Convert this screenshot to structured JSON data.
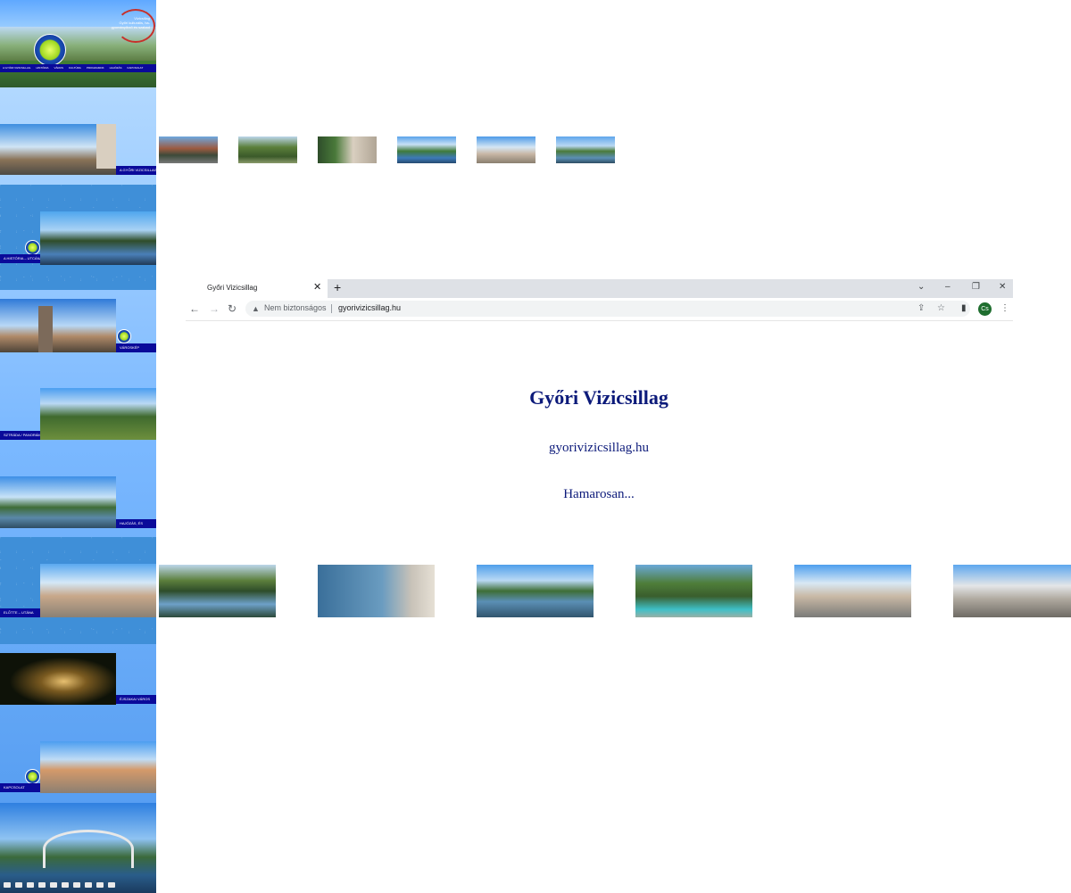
{
  "browser": {
    "tab_title": "Győri Vizicsillag",
    "security_label": "Nem biztonságos",
    "url": "gyorivizicsillag.hu",
    "profile_initials": "Cs"
  },
  "page": {
    "title": "Győri Vizicsillag",
    "domain": "gyorivizicsillag.hu",
    "status": "Hamarosan..."
  },
  "strip": {
    "header_logo_text": [
      "Vízicsillag",
      "Győri kulturális, ha-",
      "gyományőrző és szabad"
    ],
    "nav_items": [
      "A GYŐRI VIZICSILLAG",
      "HISTÓRIA",
      "VÁROS",
      "KULTÚRA",
      "PROGRAMOK",
      "HAJÓZÁS",
      "KAPCSOLAT"
    ],
    "panels": [
      {
        "bar_label": "A GYŐRI VIZICSILLAG"
      },
      {
        "bar_label": "A HISTÓRIA – UTCÁNAK"
      },
      {
        "bar_label": "VÁROSKÉP"
      },
      {
        "bar_label": "SZTRÁDA / PANORÁMA"
      },
      {
        "bar_label": "HAJÓZÁS, ÉS"
      },
      {
        "bar_label": "ELŐTTE – UTÁNA"
      },
      {
        "bar_label": "ÉJSZAKAI VÁROS"
      },
      {
        "bar_label": "KAPCSOLAT"
      }
    ]
  },
  "colors": {
    "nav_blue": "#0a0a9a",
    "title_navy": "#0c1a7a",
    "sky": "#7ab8ff"
  }
}
